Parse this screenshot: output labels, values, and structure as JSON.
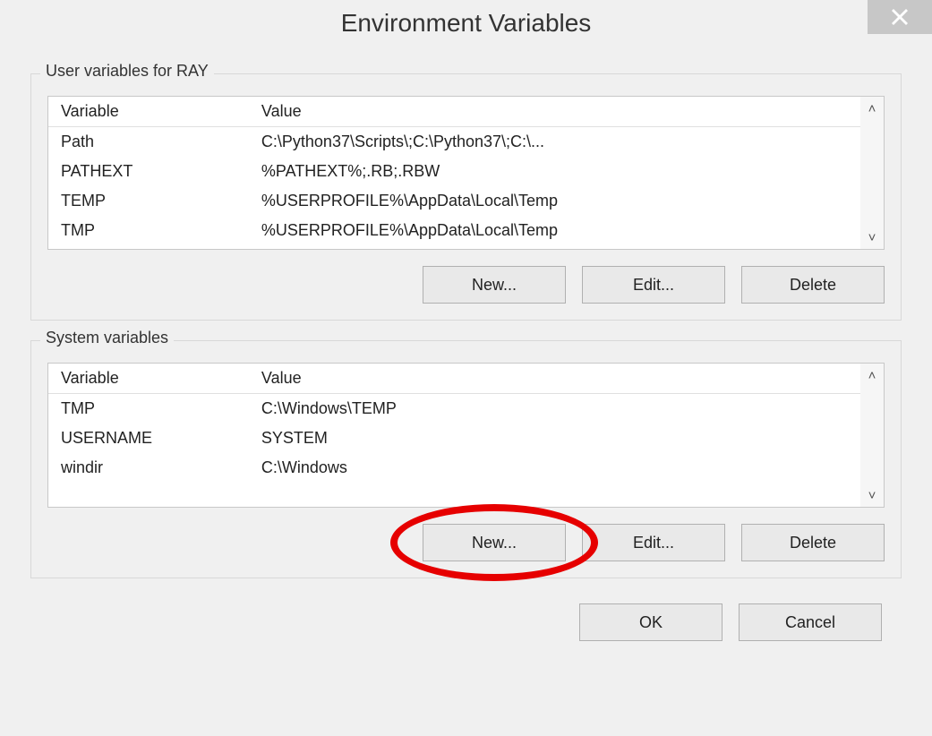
{
  "window": {
    "title": "Environment Variables"
  },
  "user_section": {
    "legend": "User variables for RAY",
    "columns": {
      "variable": "Variable",
      "value": "Value"
    },
    "rows": [
      {
        "variable": "Path",
        "value": "C:\\Python37\\Scripts\\;C:\\Python37\\;C:\\..."
      },
      {
        "variable": "PATHEXT",
        "value": "%PATHEXT%;.RB;.RBW"
      },
      {
        "variable": "TEMP",
        "value": "%USERPROFILE%\\AppData\\Local\\Temp"
      },
      {
        "variable": "TMP",
        "value": "%USERPROFILE%\\AppData\\Local\\Temp"
      }
    ],
    "buttons": {
      "new": "New...",
      "edit": "Edit...",
      "delete": "Delete"
    }
  },
  "system_section": {
    "legend": "System variables",
    "columns": {
      "variable": "Variable",
      "value": "Value"
    },
    "rows": [
      {
        "variable": "TMP",
        "value": "C:\\Windows\\TEMP"
      },
      {
        "variable": "USERNAME",
        "value": "SYSTEM"
      },
      {
        "variable": "windir",
        "value": "C:\\Windows"
      }
    ],
    "buttons": {
      "new": "New...",
      "edit": "Edit...",
      "delete": "Delete"
    }
  },
  "footer": {
    "ok": "OK",
    "cancel": "Cancel"
  }
}
